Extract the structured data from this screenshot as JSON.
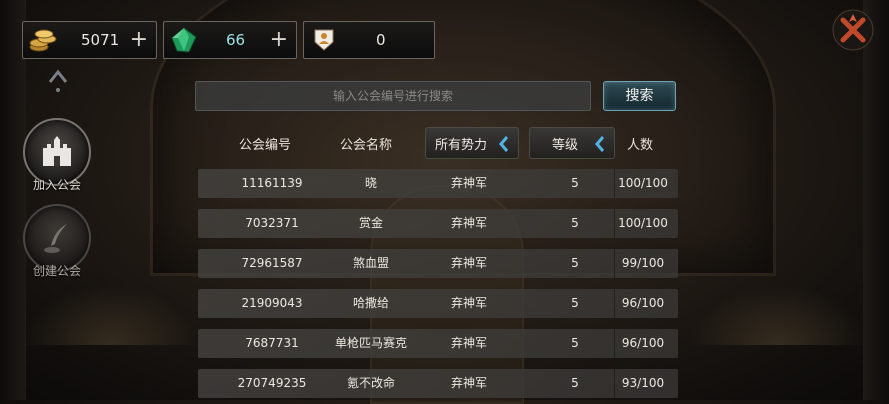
{
  "resources": {
    "gold": {
      "icon": "gold-coins-icon",
      "value": "5071",
      "plus": "+"
    },
    "gem": {
      "icon": "emerald-gem-icon",
      "value": "66",
      "plus": "+"
    },
    "badge": {
      "icon": "guild-badge-icon",
      "value": "0"
    }
  },
  "side_menu": {
    "join": {
      "label": "加入公会",
      "icon": "castle-icon"
    },
    "create": {
      "label": "创建公会",
      "icon": "quill-icon"
    }
  },
  "search": {
    "placeholder": "输入公会编号进行搜索",
    "button": "搜索"
  },
  "table": {
    "headers": {
      "id": "公会编号",
      "name": "公会名称",
      "faction": "所有势力",
      "level": "等级",
      "count": "人数"
    },
    "rows": [
      {
        "id": "11161139",
        "name": "晓",
        "faction": "弃神军",
        "level": "5",
        "count": "100/100"
      },
      {
        "id": "7032371",
        "name": "赏金",
        "faction": "弃神军",
        "level": "5",
        "count": "100/100"
      },
      {
        "id": "72961587",
        "name": "煞血盟",
        "faction": "弃神军",
        "level": "5",
        "count": "99/100"
      },
      {
        "id": "21909043",
        "name": "哈撒给",
        "faction": "弃神军",
        "level": "5",
        "count": "96/100"
      },
      {
        "id": "7687731",
        "name": "单枪匹马赛克",
        "faction": "弃神军",
        "level": "5",
        "count": "96/100"
      },
      {
        "id": "270749235",
        "name": "氪不改命",
        "faction": "弃神军",
        "level": "5",
        "count": "93/100"
      }
    ]
  },
  "colors": {
    "accent": "#3aa6c9",
    "search_button": "#1f3a43",
    "gem_text": "#9be3e6"
  }
}
